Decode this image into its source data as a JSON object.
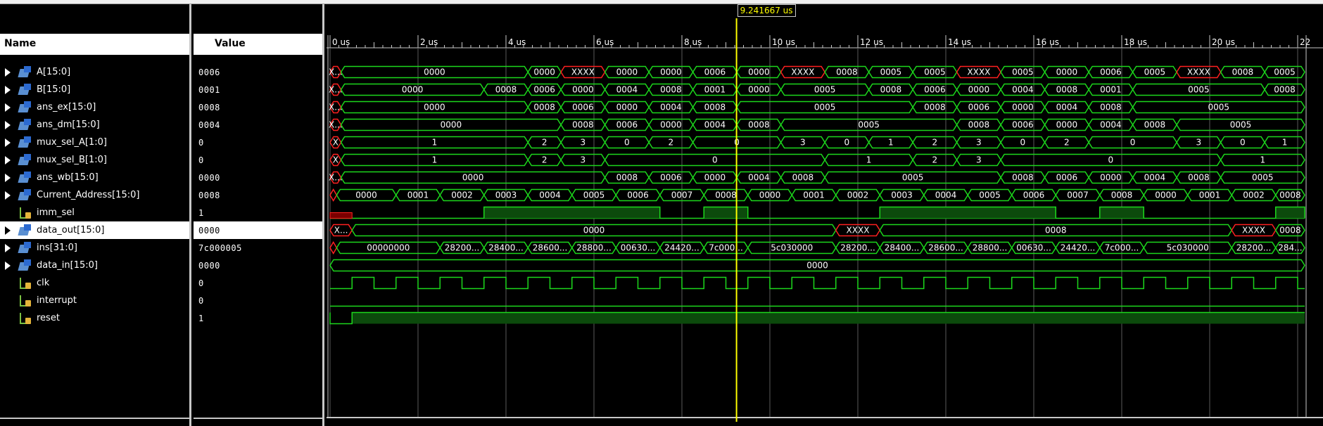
{
  "headers": {
    "name": "Name",
    "value": "Value"
  },
  "cursor_time": "9.241667 us",
  "time_ticks": [
    "0 us",
    "2 us",
    "4 us",
    "6 us",
    "8 us",
    "10 us",
    "12 us",
    "14 us",
    "16 us",
    "18 us",
    "20 us",
    "22"
  ],
  "signals": [
    {
      "name": "A[15:0]",
      "value": "0006",
      "type": "bus",
      "expandable": true
    },
    {
      "name": "B[15:0]",
      "value": "0001",
      "type": "bus",
      "expandable": true
    },
    {
      "name": "ans_ex[15:0]",
      "value": "0008",
      "type": "bus",
      "expandable": true
    },
    {
      "name": "ans_dm[15:0]",
      "value": "0004",
      "type": "bus",
      "expandable": true
    },
    {
      "name": "mux_sel_A[1:0]",
      "value": "0",
      "type": "bus",
      "expandable": true
    },
    {
      "name": "mux_sel_B[1:0]",
      "value": "0",
      "type": "bus",
      "expandable": true
    },
    {
      "name": "ans_wb[15:0]",
      "value": "0000",
      "type": "bus",
      "expandable": true
    },
    {
      "name": "Current_Address[15:0]",
      "value": "0008",
      "type": "bus",
      "expandable": true
    },
    {
      "name": "imm_sel",
      "value": "1",
      "type": "bit",
      "expandable": false
    },
    {
      "name": "data_out[15:0]",
      "value": "0000",
      "type": "bus",
      "expandable": true,
      "selected": true
    },
    {
      "name": "ins[31:0]",
      "value": "7c000005",
      "type": "bus",
      "expandable": true
    },
    {
      "name": "data_in[15:0]",
      "value": "0000",
      "type": "bus",
      "expandable": true
    },
    {
      "name": "clk",
      "value": "0",
      "type": "bit",
      "expandable": false
    },
    {
      "name": "interrupt",
      "value": "0",
      "type": "bit",
      "expandable": false
    },
    {
      "name": "reset",
      "value": "1",
      "type": "bit",
      "expandable": false
    }
  ],
  "waves": [
    {
      "kind": "bus",
      "segs": [
        [
          "X...",
          0,
          0.25,
          1
        ],
        [
          "0000",
          0.25,
          4.5,
          0
        ],
        [
          "0000",
          4.5,
          5.25,
          0
        ],
        [
          "XXXX",
          5.25,
          6.25,
          1
        ],
        [
          "0000",
          6.25,
          7.25,
          0
        ],
        [
          "0000",
          7.25,
          8.25,
          0
        ],
        [
          "0006",
          8.25,
          9.25,
          0
        ],
        [
          "0000",
          9.25,
          10.25,
          0
        ],
        [
          "XXXX",
          10.25,
          11.25,
          1
        ],
        [
          "0008",
          11.25,
          12.25,
          0
        ],
        [
          "0005",
          12.25,
          13.25,
          0
        ],
        [
          "0005",
          13.25,
          14.25,
          0
        ],
        [
          "XXXX",
          14.25,
          15.25,
          1
        ],
        [
          "0005",
          15.25,
          16.25,
          0
        ],
        [
          "0000",
          16.25,
          17.25,
          0
        ],
        [
          "0006",
          17.25,
          18.25,
          0
        ],
        [
          "0005",
          18.25,
          19.25,
          0
        ],
        [
          "XXXX",
          19.25,
          20.25,
          1
        ],
        [
          "0008",
          20.25,
          21.25,
          0
        ],
        [
          "0005",
          21.25,
          22.3,
          0
        ]
      ]
    },
    {
      "kind": "bus",
      "segs": [
        [
          "X...",
          0,
          0.25,
          1
        ],
        [
          "0000",
          0.25,
          3.5,
          0
        ],
        [
          "0008",
          3.5,
          4.5,
          0
        ],
        [
          "0006",
          4.5,
          5.25,
          0
        ],
        [
          "0000",
          5.25,
          6.25,
          0
        ],
        [
          "0004",
          6.25,
          7.25,
          0
        ],
        [
          "0008",
          7.25,
          8.25,
          0
        ],
        [
          "0001",
          8.25,
          9.25,
          0
        ],
        [
          "0000",
          9.25,
          10.25,
          0
        ],
        [
          "0005",
          10.25,
          12.25,
          0
        ],
        [
          "0008",
          12.25,
          13.25,
          0
        ],
        [
          "0006",
          13.25,
          14.25,
          0
        ],
        [
          "0000",
          14.25,
          15.25,
          0
        ],
        [
          "0004",
          15.25,
          16.25,
          0
        ],
        [
          "0008",
          16.25,
          17.25,
          0
        ],
        [
          "0001",
          17.25,
          18.25,
          0
        ],
        [
          "0005",
          18.25,
          21.25,
          0
        ],
        [
          "0008",
          21.25,
          22.3,
          0
        ]
      ]
    },
    {
      "kind": "bus",
      "segs": [
        [
          "X...",
          0,
          0.25,
          1
        ],
        [
          "0000",
          0.25,
          4.5,
          0
        ],
        [
          "0008",
          4.5,
          5.25,
          0
        ],
        [
          "0006",
          5.25,
          6.25,
          0
        ],
        [
          "0000",
          6.25,
          7.25,
          0
        ],
        [
          "0004",
          7.25,
          8.25,
          0
        ],
        [
          "0008",
          8.25,
          9.25,
          0
        ],
        [
          "0005",
          9.25,
          13.25,
          0
        ],
        [
          "0008",
          13.25,
          14.25,
          0
        ],
        [
          "0006",
          14.25,
          15.25,
          0
        ],
        [
          "0000",
          15.25,
          16.25,
          0
        ],
        [
          "0004",
          16.25,
          17.25,
          0
        ],
        [
          "0008",
          17.25,
          18.25,
          0
        ],
        [
          "0005",
          18.25,
          22.3,
          0
        ]
      ]
    },
    {
      "kind": "bus",
      "segs": [
        [
          "X...",
          0,
          0.25,
          1
        ],
        [
          "0000",
          0.25,
          5.25,
          0
        ],
        [
          "0008",
          5.25,
          6.25,
          0
        ],
        [
          "0006",
          6.25,
          7.25,
          0
        ],
        [
          "0000",
          7.25,
          8.25,
          0
        ],
        [
          "0004",
          8.25,
          9.25,
          0
        ],
        [
          "0008",
          9.25,
          10.25,
          0
        ],
        [
          "0005",
          10.25,
          14.25,
          0
        ],
        [
          "0008",
          14.25,
          15.25,
          0
        ],
        [
          "0006",
          15.25,
          16.25,
          0
        ],
        [
          "0000",
          16.25,
          17.25,
          0
        ],
        [
          "0004",
          17.25,
          18.25,
          0
        ],
        [
          "0008",
          18.25,
          19.25,
          0
        ],
        [
          "0005",
          19.25,
          22.3,
          0
        ]
      ]
    },
    {
      "kind": "bus",
      "segs": [
        [
          "X",
          0,
          0.25,
          1
        ],
        [
          "1",
          0.25,
          4.5,
          0
        ],
        [
          "2",
          4.5,
          5.25,
          0
        ],
        [
          "3",
          5.25,
          6.25,
          0
        ],
        [
          "0",
          6.25,
          7.25,
          0
        ],
        [
          "2",
          7.25,
          8.25,
          0
        ],
        [
          "0",
          8.25,
          10.25,
          0
        ],
        [
          "3",
          10.25,
          11.25,
          0
        ],
        [
          "0",
          11.25,
          12.25,
          0
        ],
        [
          "1",
          12.25,
          13.25,
          0
        ],
        [
          "2",
          13.25,
          14.25,
          0
        ],
        [
          "3",
          14.25,
          15.25,
          0
        ],
        [
          "0",
          15.25,
          16.25,
          0
        ],
        [
          "2",
          16.25,
          17.25,
          0
        ],
        [
          "0",
          17.25,
          19.25,
          0
        ],
        [
          "3",
          19.25,
          20.25,
          0
        ],
        [
          "0",
          20.25,
          21.25,
          0
        ],
        [
          "1",
          21.25,
          22.3,
          0
        ]
      ]
    },
    {
      "kind": "bus",
      "segs": [
        [
          "X",
          0,
          0.25,
          1
        ],
        [
          "1",
          0.25,
          4.5,
          0
        ],
        [
          "2",
          4.5,
          5.25,
          0
        ],
        [
          "3",
          5.25,
          6.25,
          0
        ],
        [
          "0",
          6.25,
          11.25,
          0
        ],
        [
          "1",
          11.25,
          13.25,
          0
        ],
        [
          "2",
          13.25,
          14.25,
          0
        ],
        [
          "3",
          14.25,
          15.25,
          0
        ],
        [
          "0",
          15.25,
          20.25,
          0
        ],
        [
          "1",
          20.25,
          22.3,
          0
        ]
      ]
    },
    {
      "kind": "bus",
      "segs": [
        [
          "X...",
          0,
          0.25,
          1
        ],
        [
          "0000",
          0.25,
          6.25,
          0
        ],
        [
          "0008",
          6.25,
          7.25,
          0
        ],
        [
          "0006",
          7.25,
          8.25,
          0
        ],
        [
          "0000",
          8.25,
          9.25,
          0
        ],
        [
          "0004",
          9.25,
          10.25,
          0
        ],
        [
          "0008",
          10.25,
          11.25,
          0
        ],
        [
          "0005",
          11.25,
          15.25,
          0
        ],
        [
          "0008",
          15.25,
          16.25,
          0
        ],
        [
          "0006",
          16.25,
          17.25,
          0
        ],
        [
          "0000",
          17.25,
          18.25,
          0
        ],
        [
          "0004",
          18.25,
          19.25,
          0
        ],
        [
          "0008",
          19.25,
          20.25,
          0
        ],
        [
          "0005",
          20.25,
          22.3,
          0
        ]
      ]
    },
    {
      "kind": "bus",
      "segs": [
        [
          "",
          0,
          0.15,
          1
        ],
        [
          "0000",
          0.15,
          1.5,
          0
        ],
        [
          "0001",
          1.5,
          2.5,
          0
        ],
        [
          "0002",
          2.5,
          3.5,
          0
        ],
        [
          "0003",
          3.5,
          4.5,
          0
        ],
        [
          "0004",
          4.5,
          5.5,
          0
        ],
        [
          "0005",
          5.5,
          6.5,
          0
        ],
        [
          "0006",
          6.5,
          7.5,
          0
        ],
        [
          "0007",
          7.5,
          8.5,
          0
        ],
        [
          "0008",
          8.5,
          9.5,
          0
        ],
        [
          "0000",
          9.5,
          10.5,
          0
        ],
        [
          "0001",
          10.5,
          11.5,
          0
        ],
        [
          "0002",
          11.5,
          12.5,
          0
        ],
        [
          "0003",
          12.5,
          13.5,
          0
        ],
        [
          "0004",
          13.5,
          14.5,
          0
        ],
        [
          "0005",
          14.5,
          15.5,
          0
        ],
        [
          "0006",
          15.5,
          16.5,
          0
        ],
        [
          "0007",
          16.5,
          17.5,
          0
        ],
        [
          "0008",
          17.5,
          18.5,
          0
        ],
        [
          "0000",
          18.5,
          19.5,
          0
        ],
        [
          "0001",
          19.5,
          20.5,
          0
        ],
        [
          "0002",
          20.5,
          21.5,
          0
        ],
        [
          "0008",
          21.5,
          22.3,
          0
        ]
      ]
    },
    {
      "kind": "bit",
      "high": [
        [
          3.5,
          7.5
        ],
        [
          8.5,
          9.5
        ],
        [
          12.5,
          16.5
        ],
        [
          17.5,
          18.5
        ],
        [
          21.5,
          22.3
        ]
      ],
      "redStart": [
        0,
        0.5
      ]
    },
    {
      "kind": "bus",
      "segs": [
        [
          "X...",
          0,
          0.5,
          1
        ],
        [
          "0000",
          0.5,
          11.5,
          0
        ],
        [
          "XXXX",
          11.5,
          12.5,
          1
        ],
        [
          "0008",
          12.5,
          20.5,
          0
        ],
        [
          "XXXX",
          20.5,
          21.5,
          1
        ],
        [
          "0008",
          21.5,
          22.3,
          0
        ]
      ]
    },
    {
      "kind": "bus",
      "segs": [
        [
          "",
          0,
          0.15,
          1
        ],
        [
          "00000000",
          0.15,
          2.5,
          0
        ],
        [
          "28200...",
          2.5,
          3.5,
          0
        ],
        [
          "28400...",
          3.5,
          4.5,
          0
        ],
        [
          "28600...",
          4.5,
          5.5,
          0
        ],
        [
          "28800...",
          5.5,
          6.5,
          0
        ],
        [
          "00630...",
          6.5,
          7.5,
          0
        ],
        [
          "24420...",
          7.5,
          8.5,
          0
        ],
        [
          "7c000...",
          8.5,
          9.5,
          0
        ],
        [
          "5c030000",
          9.5,
          11.5,
          0
        ],
        [
          "28200...",
          11.5,
          12.5,
          0
        ],
        [
          "28400...",
          12.5,
          13.5,
          0
        ],
        [
          "28600...",
          13.5,
          14.5,
          0
        ],
        [
          "28800...",
          14.5,
          15.5,
          0
        ],
        [
          "00630...",
          15.5,
          16.5,
          0
        ],
        [
          "24420...",
          16.5,
          17.5,
          0
        ],
        [
          "7c000...",
          17.5,
          18.5,
          0
        ],
        [
          "5c030000",
          18.5,
          20.5,
          0
        ],
        [
          "28200...",
          20.5,
          21.5,
          0
        ],
        [
          "284...",
          21.5,
          22.3,
          0
        ]
      ]
    },
    {
      "kind": "bus",
      "segs": [
        [
          "0000",
          0,
          22.3,
          0
        ]
      ]
    },
    {
      "kind": "clk"
    },
    {
      "kind": "bit",
      "high": []
    },
    {
      "kind": "reset"
    }
  ]
}
